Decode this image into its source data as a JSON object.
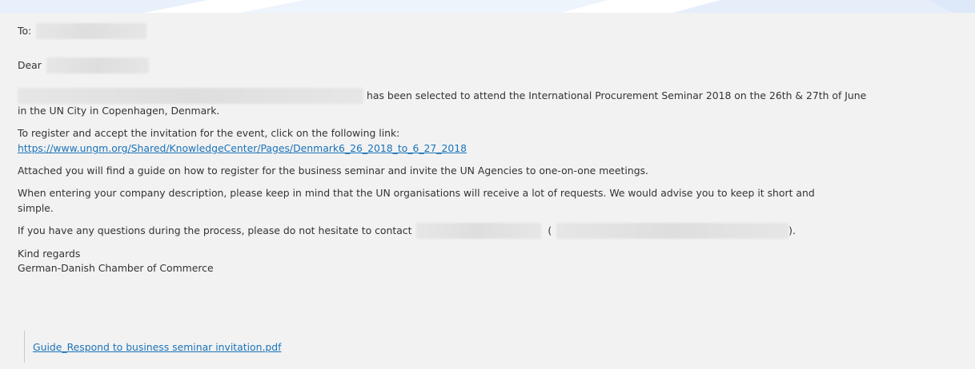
{
  "email": {
    "to_label": "To:",
    "greeting": "Dear",
    "selection_text": "has been selected to attend the International Procurement Seminar 2018 on the 26th & 27th of June",
    "selection_text_cont": "in the UN City in Copenhagen, Denmark.",
    "register_text": "To register and accept the invitation for the event, click on the following link:",
    "register_link": "https://www.ungm.org/Shared/KnowledgeCenter/Pages/Denmark6_26_2018_to_6_27_2018",
    "attached_text": "Attached you will find a guide on how to register for the business seminar and invite the UN Agencies to one-on-one meetings.",
    "description_text": "When entering your company description, please keep in mind that the UN organisations will receive a lot of requests. We would advise you to keep it short and",
    "description_text_cont": "simple.",
    "questions_text": "If you have any questions during the process, please do not hesitate to contact",
    "paren_open": "(",
    "paren_close": ").",
    "closing": "Kind regards",
    "signature": "German-Danish Chamber of Commerce",
    "attachment_name": "Guide_Respond to business seminar invitation.pdf"
  },
  "colors": {
    "link": "#1a73b9",
    "background": "#f2f2f2",
    "text": "#333333"
  }
}
